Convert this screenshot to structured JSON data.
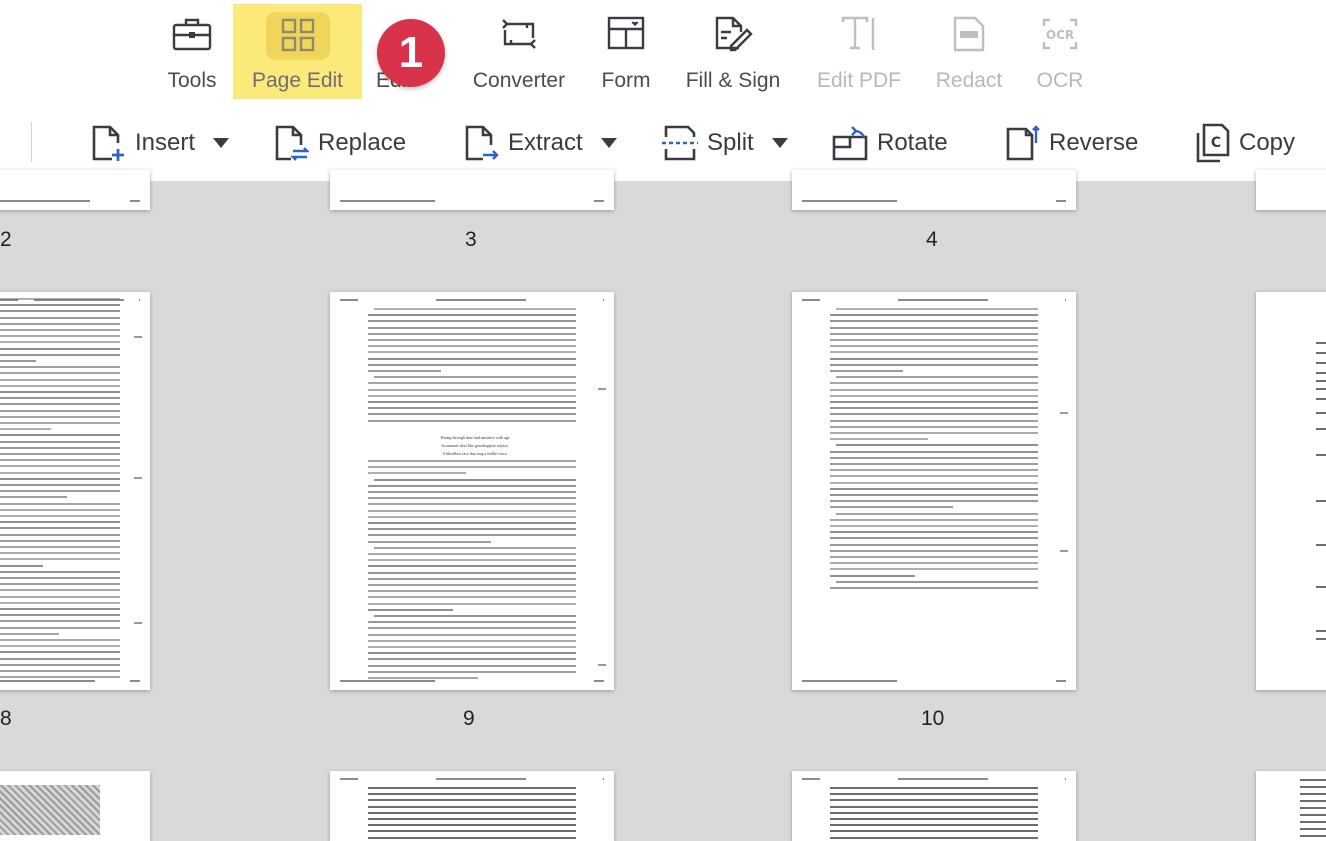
{
  "toolbar": {
    "tools": [
      {
        "label": "Tools",
        "icon": "briefcase-icon",
        "state": "normal"
      },
      {
        "label": "Page Edit",
        "icon": "grid-icon",
        "state": "active"
      },
      {
        "label": "Edit",
        "icon": "edit-icon",
        "state": "hidden-behind-badge"
      },
      {
        "label": "Converter",
        "icon": "converter-icon",
        "state": "normal"
      },
      {
        "label": "Form",
        "icon": "form-icon",
        "state": "normal"
      },
      {
        "label": "Fill & Sign",
        "icon": "sign-icon",
        "state": "normal"
      },
      {
        "label": "Edit PDF",
        "icon": "text-cursor-icon",
        "state": "disabled"
      },
      {
        "label": "Redact",
        "icon": "redact-icon",
        "state": "disabled"
      },
      {
        "label": "OCR",
        "icon": "ocr-icon",
        "state": "disabled"
      }
    ],
    "badge": "1",
    "accent_color": "#fbe97a",
    "badge_color": "#d8334a"
  },
  "page_actions": {
    "insert": "Insert",
    "replace": "Replace",
    "extract": "Extract",
    "split": "Split",
    "rotate": "Rotate",
    "reverse": "Reverse",
    "copy": "Copy"
  },
  "pages": {
    "row1": [
      "2",
      "3",
      "4"
    ],
    "row2": [
      "8",
      "9",
      "10"
    ]
  },
  "page_content": {
    "p9_poem": [
      "Wrung through time and narrative with age",
      "In summer days like grasshoppers rejoice,",
      "A bloodless race that sing a feeble voice."
    ]
  }
}
